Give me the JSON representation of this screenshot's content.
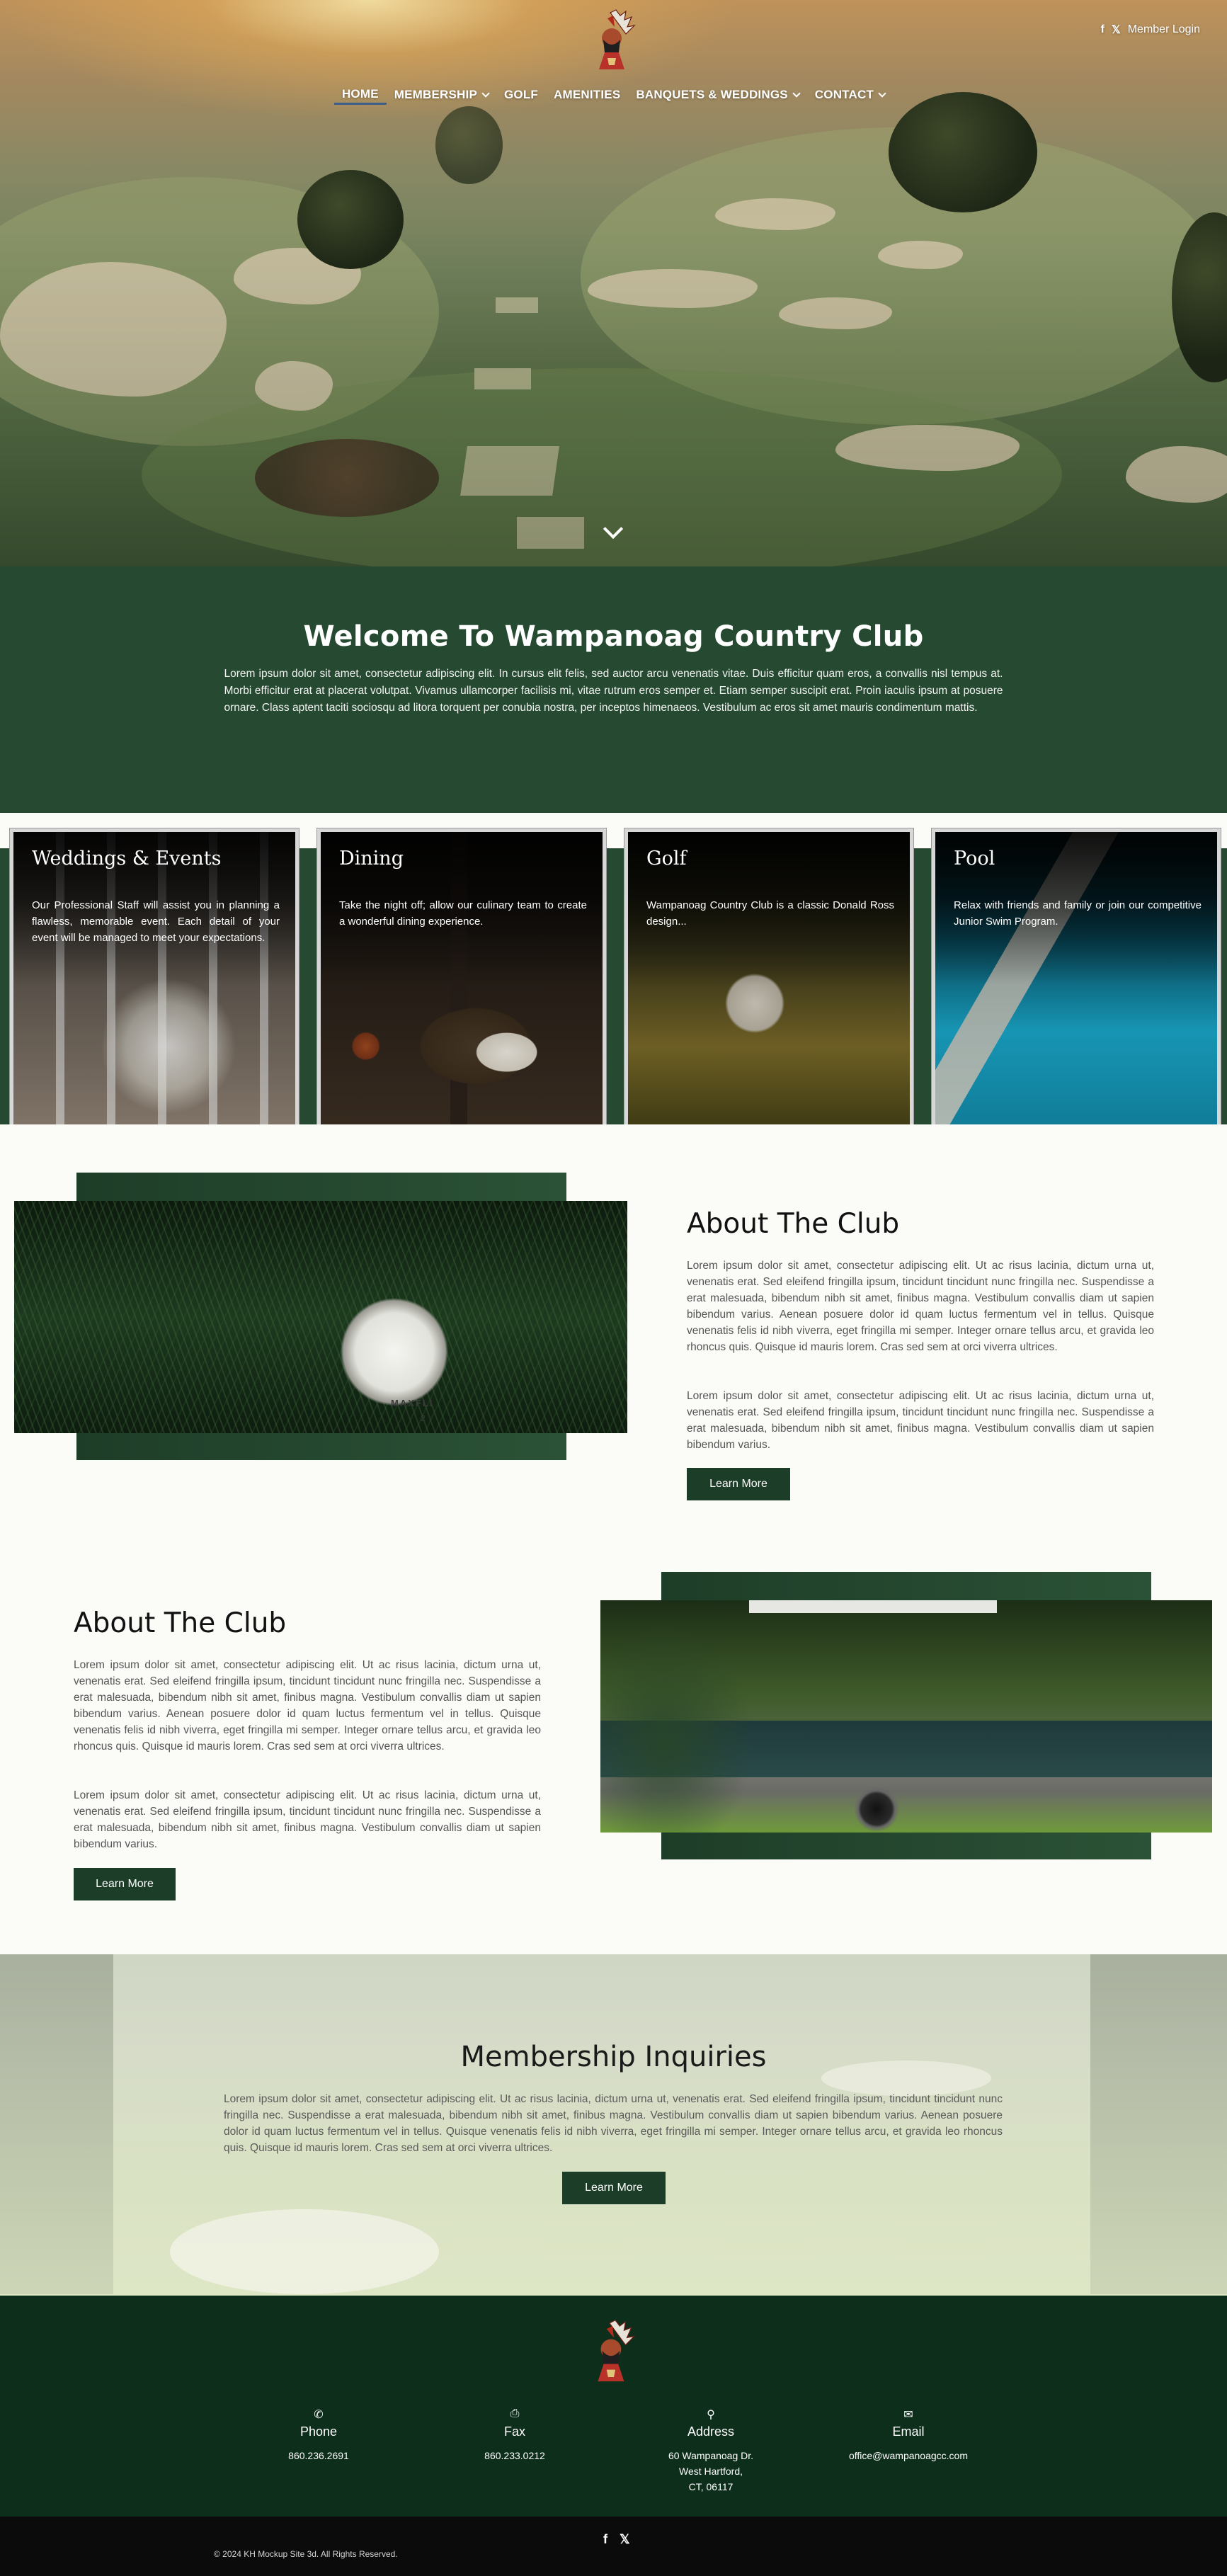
{
  "header": {
    "nav": [
      {
        "label": "HOME",
        "has_dropdown": false,
        "active": true
      },
      {
        "label": "MEMBERSHIP",
        "has_dropdown": true,
        "active": false
      },
      {
        "label": "GOLF",
        "has_dropdown": false,
        "active": false
      },
      {
        "label": "AMENITIES",
        "has_dropdown": false,
        "active": false
      },
      {
        "label": "BANQUETS & WEDDINGS",
        "has_dropdown": true,
        "active": false
      },
      {
        "label": "CONTACT",
        "has_dropdown": true,
        "active": false
      }
    ],
    "social": {
      "facebook": "f",
      "x": "𝕏"
    },
    "member_login": "Member Login",
    "icons": [
      "club-logo",
      "facebook-icon",
      "x-icon",
      "chevron-down-icon"
    ]
  },
  "welcome": {
    "title": "Welcome To Wampanoag Country Club",
    "body": "Lorem ipsum dolor sit amet, consectetur adipiscing elit. In cursus elit felis, sed auctor arcu venenatis vitae. Duis efficitur quam eros, a convallis nisl tempus at. Morbi efficitur erat at placerat volutpat. Vivamus ullamcorper facilisis mi, vitae rutrum eros semper et. Etiam semper suscipit erat. Proin iaculis ipsum at posuere ornare. Class aptent taciti sociosqu ad litora torquent per conubia nostra, per inceptos himenaeos. Vestibulum ac eros sit amet mauris condimentum mattis."
  },
  "cards": [
    {
      "title": "Weddings & Events",
      "text": "Our Professional Staff will assist you in planning a flawless, memorable event. Each detail of your event will be managed to meet your expectations."
    },
    {
      "title": "Dining",
      "text": "Take the night off; allow our culinary team to create a wonderful dining experience."
    },
    {
      "title": "Golf",
      "text": "Wampanoag Country Club is a classic Donald Ross design..."
    },
    {
      "title": "Pool",
      "text": "Relax with friends and family or join our competitive Junior Swim Program."
    }
  ],
  "about1": {
    "title": "About The Club",
    "p1": "Lorem ipsum dolor sit amet, consectetur adipiscing elit. Ut ac risus lacinia, dictum urna ut, venenatis erat. Sed eleifend fringilla ipsum, tincidunt tincidunt nunc fringilla nec. Suspendisse a erat malesuada, bibendum nibh sit amet, finibus magna. Vestibulum convallis diam ut sapien bibendum varius. Aenean posuere dolor id quam luctus fermentum vel in tellus. Quisque venenatis felis id nibh viverra, eget fringilla mi semper. Integer ornare tellus arcu, et gravida leo rhoncus quis. Quisque id mauris lorem. Cras sed sem at orci viverra ultrices.",
    "p2": "Lorem ipsum dolor sit amet, consectetur adipiscing elit. Ut ac risus lacinia, dictum urna ut, venenatis erat. Sed eleifend fringilla ipsum, tincidunt tincidunt nunc fringilla nec. Suspendisse a erat malesuada, bibendum nibh sit amet, finibus magna. Vestibulum convallis diam ut sapien bibendum varius.",
    "button": "Learn More",
    "ball_brand": "MAXFLI",
    "ball_number": "2"
  },
  "about2": {
    "title": "About The Club",
    "p1": "Lorem ipsum dolor sit amet, consectetur adipiscing elit. Ut ac risus lacinia, dictum urna ut, venenatis erat. Sed eleifend fringilla ipsum, tincidunt tincidunt nunc fringilla nec. Suspendisse a erat malesuada, bibendum nibh sit amet, finibus magna. Vestibulum convallis diam ut sapien bibendum varius. Aenean posuere dolor id quam luctus fermentum vel in tellus. Quisque venenatis felis id nibh viverra, eget fringilla mi semper. Integer ornare tellus arcu, et gravida leo rhoncus quis. Quisque id mauris lorem. Cras sed sem at orci viverra ultrices.",
    "p2": "Lorem ipsum dolor sit amet, consectetur adipiscing elit. Ut ac risus lacinia, dictum urna ut, venenatis erat. Sed eleifend fringilla ipsum, tincidunt tincidunt nunc fringilla nec. Suspendisse a erat malesuada, bibendum nibh sit amet, finibus magna. Vestibulum convallis diam ut sapien bibendum varius.",
    "button": "Learn More"
  },
  "membership": {
    "title": "Membership Inquiries",
    "body": "Lorem ipsum dolor sit amet, consectetur adipiscing elit. Ut ac risus lacinia, dictum urna ut, venenatis erat. Sed eleifend fringilla ipsum, tincidunt tincidunt nunc fringilla nec. Suspendisse a erat malesuada, bibendum nibh sit amet, finibus magna. Vestibulum convallis diam ut sapien bibendum varius. Aenean posuere dolor id quam luctus fermentum vel in tellus. Quisque venenatis felis id nibh viverra, eget fringilla mi semper. Integer ornare tellus arcu, et gravida leo rhoncus quis. Quisque id mauris lorem. Cras sed sem at orci viverra ultrices.",
    "button": "Learn More"
  },
  "footer": {
    "contacts": [
      {
        "icon": "phone-icon",
        "glyph": "✆",
        "label": "Phone",
        "value": "860.236.2691"
      },
      {
        "icon": "fax-icon",
        "glyph": "⎙",
        "label": "Fax",
        "value": "860.233.0212"
      },
      {
        "icon": "map-pin-icon",
        "glyph": "⚲",
        "label": "Address",
        "value": "60 Wampanoag Dr.\nWest Hartford,\nCT, 06117"
      },
      {
        "icon": "envelope-icon",
        "glyph": "✉",
        "label": "Email",
        "value": "office@wampanoagcc.com"
      }
    ],
    "social": "f 𝕏",
    "copyright": "© 2024  KH Mockup Site 3d. All Rights Reserved."
  },
  "colors": {
    "primary_green": "#264a31",
    "dark_green": "#0e2e1c",
    "button_green": "#1c3d27",
    "active_underline": "#3d5e8a"
  }
}
